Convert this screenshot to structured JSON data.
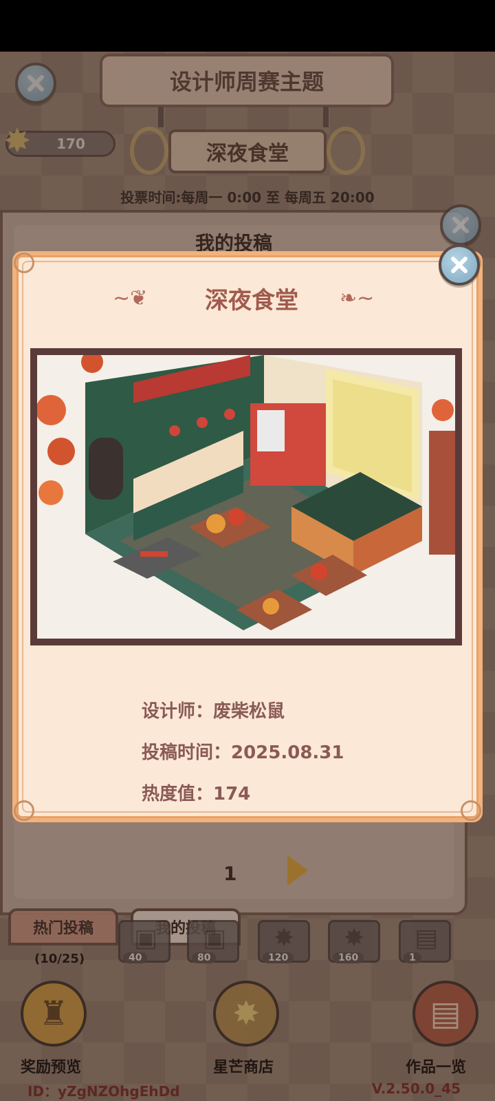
{
  "header": {
    "title": "设计师周赛主题",
    "theme": "深夜食堂",
    "vote_time": "投票时间:每周一 0:00 至 每周五 20:00",
    "stars": "170"
  },
  "under_panel": {
    "title": "我的投稿",
    "page": "1",
    "tabs": [
      "热门投稿",
      "我的投稿"
    ],
    "tab_count": "(10/25)",
    "milestones": [
      "40",
      "80",
      "120",
      "160",
      "1"
    ]
  },
  "card": {
    "title": "深夜食堂",
    "designer": "设计师：废柴松鼠",
    "submit_time": "投稿时间：2025.08.31",
    "heat": "热度值：174"
  },
  "bottom_nav": {
    "reward": "奖励预览",
    "shop": "星芒商店",
    "works": "作品一览"
  },
  "footer": {
    "id": "ID：yZgNZOhgEhDd",
    "version": "V.2.50.0_45"
  },
  "colors": {
    "card_bg": "#fbe8d6",
    "card_border": "#f2b27b",
    "title_text": "#a15a4e",
    "info_text": "#8a5a55"
  }
}
